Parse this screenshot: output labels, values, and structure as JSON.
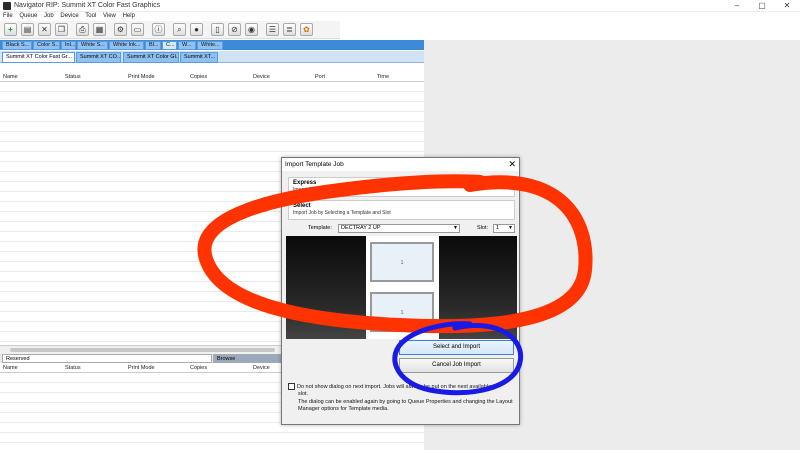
{
  "window": {
    "title": "Navigator RIP: Summit XT Color Fast Graphics"
  },
  "menu": [
    "File",
    "Queue",
    "Job",
    "Device",
    "Tool",
    "View",
    "Help"
  ],
  "toolbar_icons": [
    "new-icon",
    "open-icon",
    "delete-icon",
    "copy-icon",
    "print-icon",
    "rip-icon",
    "settings-icon",
    "layout-icon",
    "info-icon",
    "zoom-icon",
    "stop-icon",
    "pause-icon",
    "cancel-icon",
    "list-icon",
    "queue-icon",
    "color-icon"
  ],
  "queue_tabs": [
    "Black S...",
    "Color S...",
    "Inl...",
    "White S...",
    "White Ink...",
    "Bl...",
    "C...",
    "W...",
    "White..."
  ],
  "job_tabs": [
    "Summit XT Color Fast Gr...",
    "Summit XT CO...",
    "Summit XT Color Gl...",
    "Summit XT..."
  ],
  "columns": [
    "Name",
    "Status",
    "Print Mode",
    "Copies",
    "Device",
    "Port",
    "Time"
  ],
  "lower_tabs": {
    "reserved": "Reserved",
    "browse": "Browse"
  },
  "dialog": {
    "title": "Import Template Job",
    "close": "✕",
    "express_heading": "Express",
    "express_desc": "Import Job Filling Next Available Em",
    "select_heading": "Select",
    "select_desc": "Import Job by Selecting a Template and Slot",
    "template_label": "Template:",
    "template_value": "DECTRAY 2 UP",
    "slot_label": "Slot:",
    "slot_value": "1",
    "slot1_label": "1",
    "slot2_label": "1",
    "select_import_button": "Select and Import",
    "cancel_button": "Cancel Job Import",
    "notice_line1": "Do not show dialog on next import. Jobs will always be put on the next available te",
    "notice_line1b": "slot.",
    "notice_line2": "The dialog can be enabled again by going to Queue Properties and changing the Layout Manager options for Template media."
  },
  "colors": {
    "annotation_orange": "#ff3300",
    "annotation_blue": "#1a1ae6",
    "tab_blue": "#3d8ad6"
  }
}
